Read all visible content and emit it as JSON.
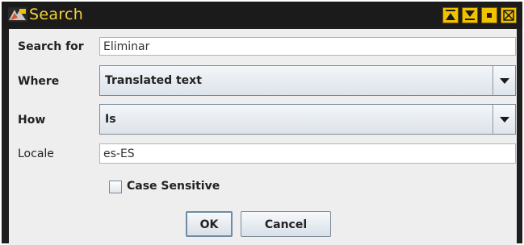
{
  "window": {
    "title": "Search",
    "controls": [
      "minimize-icon",
      "maximize-icon",
      "restore-icon",
      "close-icon"
    ]
  },
  "form": {
    "search_for": {
      "label": "Search for",
      "value": "Eliminar"
    },
    "where": {
      "label": "Where",
      "selected": "Translated text"
    },
    "how": {
      "label": "How",
      "selected": "Is"
    },
    "locale": {
      "label": "Locale",
      "value": "es-ES"
    },
    "case_sensitive": {
      "label": "Case Sensitive",
      "checked": false
    }
  },
  "buttons": {
    "ok": "OK",
    "cancel": "Cancel"
  },
  "colors": {
    "title_text": "#f2d13a",
    "titlebar": "#1b1b1b",
    "title_buttons": "#f2c200",
    "panel": "#eeeeee"
  }
}
